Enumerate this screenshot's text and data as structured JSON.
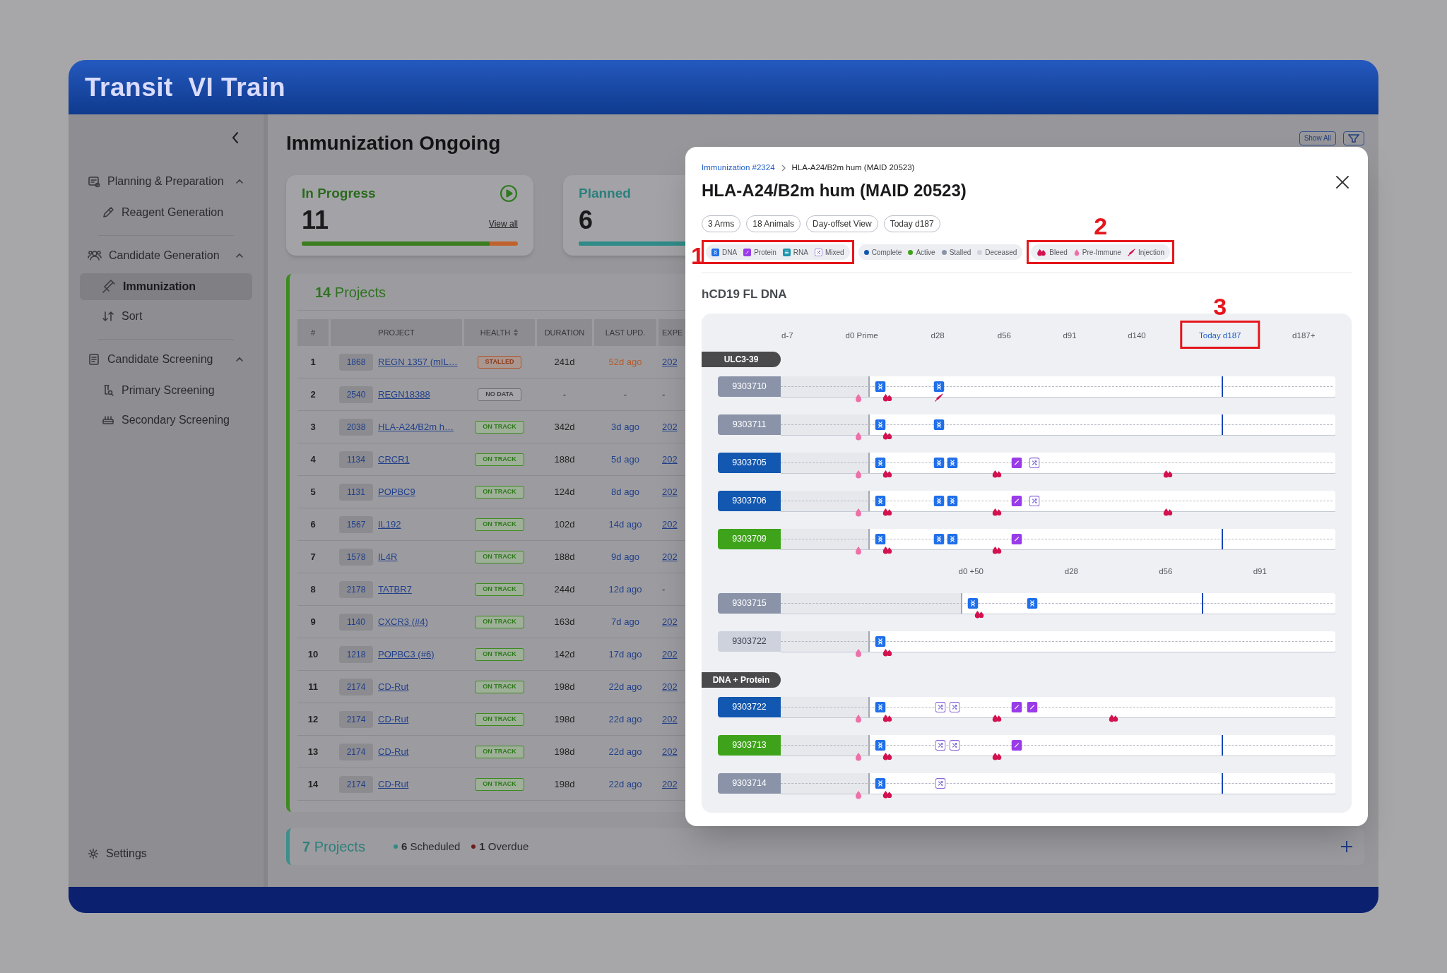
{
  "app": {
    "title": "Transit  VI Train"
  },
  "sidebar": {
    "sections": [
      {
        "label": "Planning & Preparation",
        "expanded": true,
        "items": [
          {
            "label": "Reagent Generation",
            "selected": false
          }
        ]
      },
      {
        "label": "Candidate Generation",
        "expanded": true,
        "items": [
          {
            "label": "Immunization",
            "selected": true
          },
          {
            "label": "Sort",
            "selected": false
          }
        ]
      },
      {
        "label": "Candidate Screening",
        "expanded": true,
        "items": [
          {
            "label": "Primary Screening",
            "selected": false
          },
          {
            "label": "Secondary Screening",
            "selected": false
          }
        ]
      }
    ],
    "settings": "Settings"
  },
  "main": {
    "title": "Immunization Ongoing",
    "show_all": "Show All",
    "cards": [
      {
        "title": "In Progress",
        "kind": "progress",
        "count": "11",
        "link": "View all",
        "level": 0.87
      },
      {
        "title": "Planned",
        "kind": "planned",
        "count": "6",
        "level": 1
      }
    ],
    "projects": {
      "heading": "**14** Projects",
      "columns": [
        {
          "label": "#",
          "sortable": false
        },
        {
          "label": "PROJECT",
          "sortable": false
        },
        {
          "label": "HEALTH",
          "sortable": true
        },
        {
          "label": "DURATION",
          "sortable": false
        },
        {
          "label": "LAST UPD.",
          "sortable": false
        },
        {
          "label": "EXPE",
          "sortable": false
        }
      ],
      "rows": [
        {
          "num": "1",
          "id": "1868",
          "name": "REGN 1357 (mIL…",
          "health": "STALLED",
          "kind": "stalled",
          "duration": "241d",
          "last_update": "52d ago",
          "late": true,
          "muted": false,
          "expected": "202",
          "expected_link": true
        },
        {
          "num": "2",
          "id": "2540",
          "name": "REGN18388",
          "health": "NO DATA",
          "kind": "none",
          "duration": "-",
          "last_update": "-",
          "late": false,
          "muted": true,
          "expected": "-",
          "expected_link": false
        },
        {
          "num": "3",
          "id": "2038",
          "name": "HLA-A24/B2m h…",
          "health": "ON TRACK",
          "kind": "ok",
          "duration": "342d",
          "last_update": "3d ago",
          "late": false,
          "muted": false,
          "expected": "202",
          "expected_link": true
        },
        {
          "num": "4",
          "id": "1134",
          "name": "CRCR1",
          "health": "ON TRACK",
          "kind": "ok",
          "duration": "188d",
          "last_update": "5d ago",
          "late": false,
          "muted": false,
          "expected": "202",
          "expected_link": true
        },
        {
          "num": "5",
          "id": "1131",
          "name": "POPBC9",
          "health": "ON TRACK",
          "kind": "ok",
          "duration": "124d",
          "last_update": "8d ago",
          "late": false,
          "muted": false,
          "expected": "202",
          "expected_link": true
        },
        {
          "num": "6",
          "id": "1567",
          "name": "IL192",
          "health": "ON TRACK",
          "kind": "ok",
          "duration": "102d",
          "last_update": "14d ago",
          "late": false,
          "muted": false,
          "expected": "202",
          "expected_link": true
        },
        {
          "num": "7",
          "id": "1578",
          "name": "IL4R",
          "health": "ON TRACK",
          "kind": "ok",
          "duration": "188d",
          "last_update": "9d ago",
          "late": false,
          "muted": false,
          "expected": "202",
          "expected_link": true
        },
        {
          "num": "8",
          "id": "2178",
          "name": "TATBR7",
          "health": "ON TRACK",
          "kind": "ok",
          "duration": "244d",
          "last_update": "12d ago",
          "late": false,
          "muted": false,
          "expected": "-",
          "expected_link": false
        },
        {
          "num": "9",
          "id": "1140",
          "name": "CXCR3 (#4)",
          "health": "ON TRACK",
          "kind": "ok",
          "duration": "163d",
          "last_update": "7d ago",
          "late": false,
          "muted": false,
          "expected": "202",
          "expected_link": true
        },
        {
          "num": "10",
          "id": "1218",
          "name": "POPBC3 (#6)",
          "health": "ON TRACK",
          "kind": "ok",
          "duration": "142d",
          "last_update": "17d ago",
          "late": false,
          "muted": false,
          "expected": "202",
          "expected_link": true
        },
        {
          "num": "11",
          "id": "2174",
          "name": "CD-Rut",
          "health": "ON TRACK",
          "kind": "ok",
          "duration": "198d",
          "last_update": "22d ago",
          "late": false,
          "muted": false,
          "expected": "202",
          "expected_link": true
        },
        {
          "num": "12",
          "id": "2174",
          "name": "CD-Rut",
          "health": "ON TRACK",
          "kind": "ok",
          "duration": "198d",
          "last_update": "22d ago",
          "late": false,
          "muted": false,
          "expected": "202",
          "expected_link": true
        },
        {
          "num": "13",
          "id": "2174",
          "name": "CD-Rut",
          "health": "ON TRACK",
          "kind": "ok",
          "duration": "198d",
          "last_update": "22d ago",
          "late": false,
          "muted": false,
          "expected": "202",
          "expected_link": true
        },
        {
          "num": "14",
          "id": "2174",
          "name": "CD-Rut",
          "health": "ON TRACK",
          "kind": "ok",
          "duration": "198d",
          "last_update": "22d ago",
          "late": false,
          "muted": false,
          "expected": "202",
          "expected_link": true
        }
      ]
    },
    "scheduled": {
      "heading": "**7** Projects",
      "stats": [
        {
          "text": "**6** Scheduled",
          "color": "#2f8a84"
        },
        {
          "text": "**1** Overdue",
          "color": "#6e1c1c"
        }
      ]
    }
  },
  "modal": {
    "breadcrumb": [
      "Immunization #2324",
      "HLA-A24/B2m hum (MAID 20523)"
    ],
    "title": "HLA-A24/B2m hum (MAID 20523)",
    "chips": [
      "3 Arms",
      "18 Animals",
      "Day-offset View",
      "Today d187"
    ],
    "legend": [
      {
        "kind": "types",
        "annotation": {
          "label": "1",
          "kind": "left"
        },
        "items": [
          {
            "label": "DNA",
            "kind": "dna"
          },
          {
            "label": "Protein",
            "kind": "protein"
          },
          {
            "label": "RNA",
            "kind": "rna"
          },
          {
            "label": "Mixed",
            "kind": "mixed"
          }
        ]
      },
      {
        "kind": "statuses",
        "items": [
          {
            "label": "Complete",
            "kind": "complete",
            "color": "#1257b0"
          },
          {
            "label": "Active",
            "kind": "active",
            "color": "#3ea31a"
          },
          {
            "label": "Stalled",
            "kind": "stalled",
            "color": "#8a93a8"
          },
          {
            "label": "Deceased",
            "kind": "deceased",
            "color": "#cdd2dd"
          }
        ]
      },
      {
        "kind": "events",
        "annotation": {
          "label": "2",
          "kind": "top"
        },
        "items": [
          {
            "label": "Bleed",
            "kind": "bleed"
          },
          {
            "label": "Pre-Immune",
            "kind": "pre_immune"
          },
          {
            "label": "Injection",
            "kind": "injection"
          }
        ]
      }
    ],
    "section": "hCD19 FL DNA",
    "timeline": [
      {
        "kind": "axis",
        "ticks": [
          {
            "label": "d-7",
            "today": false
          },
          {
            "label": "d0 Prime",
            "today": false
          },
          {
            "label": "d28",
            "today": false
          },
          {
            "label": "d56",
            "today": false
          },
          {
            "label": "d91",
            "today": false
          },
          {
            "label": "d140",
            "today": false
          },
          {
            "label": "Today d187",
            "today": true,
            "annotation": {
              "label": "3",
              "kind": "top"
            }
          },
          {
            "label": "d187+",
            "today": false
          }
        ]
      },
      {
        "kind": "group",
        "label": "ULC3-39"
      },
      {
        "kind": "animal",
        "id": "9303710",
        "color": "#8a93a8",
        "events": [
          {
            "kind": "start",
            "level": 0.161
          },
          {
            "kind": "dna",
            "level": 0.179
          },
          {
            "kind": "dna",
            "level": 0.285
          },
          {
            "kind": "today",
            "level": 0.795
          },
          {
            "kind": "pre_immune",
            "level": 0.14
          },
          {
            "kind": "bleed",
            "level": 0.192
          },
          {
            "kind": "injection",
            "level": 0.285
          }
        ]
      },
      {
        "kind": "animal",
        "id": "9303711",
        "color": "#8a93a8",
        "events": [
          {
            "kind": "start",
            "level": 0.161
          },
          {
            "kind": "dna",
            "level": 0.179
          },
          {
            "kind": "dna",
            "level": 0.285
          },
          {
            "kind": "today",
            "level": 0.795
          },
          {
            "kind": "pre_immune",
            "level": 0.14
          },
          {
            "kind": "bleed",
            "level": 0.192
          }
        ]
      },
      {
        "kind": "animal",
        "id": "9303705",
        "color": "#1257b0",
        "events": [
          {
            "kind": "start",
            "level": 0.161
          },
          {
            "kind": "dna",
            "level": 0.179
          },
          {
            "kind": "dna",
            "level": 0.285
          },
          {
            "kind": "dna",
            "level": 0.31
          },
          {
            "kind": "protein",
            "level": 0.426
          },
          {
            "kind": "mixed",
            "level": 0.457
          },
          {
            "kind": "pre_immune",
            "level": 0.14
          },
          {
            "kind": "bleed",
            "level": 0.192
          },
          {
            "kind": "bleed",
            "level": 0.39
          },
          {
            "kind": "bleed",
            "level": 0.698
          }
        ]
      },
      {
        "kind": "animal",
        "id": "9303706",
        "color": "#1257b0",
        "events": [
          {
            "kind": "start",
            "level": 0.161
          },
          {
            "kind": "dna",
            "level": 0.179
          },
          {
            "kind": "dna",
            "level": 0.285
          },
          {
            "kind": "dna",
            "level": 0.31
          },
          {
            "kind": "protein",
            "level": 0.426
          },
          {
            "kind": "mixed",
            "level": 0.457
          },
          {
            "kind": "pre_immune",
            "level": 0.14
          },
          {
            "kind": "bleed",
            "level": 0.192
          },
          {
            "kind": "bleed",
            "level": 0.39
          },
          {
            "kind": "bleed",
            "level": 0.698
          }
        ]
      },
      {
        "kind": "animal",
        "id": "9303709",
        "color": "#3ea31a",
        "events": [
          {
            "kind": "start",
            "level": 0.161
          },
          {
            "kind": "dna",
            "level": 0.179
          },
          {
            "kind": "dna",
            "level": 0.285
          },
          {
            "kind": "dna",
            "level": 0.31
          },
          {
            "kind": "protein",
            "level": 0.426
          },
          {
            "kind": "today",
            "level": 0.795
          },
          {
            "kind": "pre_immune",
            "level": 0.14
          },
          {
            "kind": "bleed",
            "level": 0.192
          },
          {
            "kind": "bleed",
            "level": 0.39
          }
        ]
      },
      {
        "kind": "axis",
        "ticks": [
          {
            "label": "d0 +50",
            "today": false
          },
          {
            "label": "d28",
            "today": false
          },
          {
            "label": "d56",
            "today": false
          },
          {
            "label": "d91",
            "today": false
          }
        ]
      },
      {
        "kind": "animal",
        "id": "9303715",
        "color": "#8a93a8",
        "events": [
          {
            "kind": "start",
            "level": 0.328
          },
          {
            "kind": "dna",
            "level": 0.346
          },
          {
            "kind": "dna",
            "level": 0.453
          },
          {
            "kind": "today",
            "level": 0.759
          },
          {
            "kind": "bleed",
            "level": 0.358
          }
        ]
      },
      {
        "kind": "animal",
        "id": "9303722",
        "color": "#cdd2dd",
        "events": [
          {
            "kind": "start",
            "level": 0.161
          },
          {
            "kind": "dna",
            "level": 0.179
          },
          {
            "kind": "pre_immune",
            "level": 0.14
          },
          {
            "kind": "bleed",
            "level": 0.192
          }
        ]
      },
      {
        "kind": "group",
        "label": "DNA + Protein"
      },
      {
        "kind": "animal",
        "id": "9303722",
        "color": "#1257b0",
        "events": [
          {
            "kind": "start",
            "level": 0.161
          },
          {
            "kind": "dna",
            "level": 0.179
          },
          {
            "kind": "mixed",
            "level": 0.288
          },
          {
            "kind": "mixed",
            "level": 0.314
          },
          {
            "kind": "protein",
            "level": 0.426
          },
          {
            "kind": "protein",
            "level": 0.453
          },
          {
            "kind": "pre_immune",
            "level": 0.14
          },
          {
            "kind": "bleed",
            "level": 0.192
          },
          {
            "kind": "bleed",
            "level": 0.39
          },
          {
            "kind": "bleed",
            "level": 0.6
          }
        ]
      },
      {
        "kind": "animal",
        "id": "9303713",
        "color": "#3ea31a",
        "events": [
          {
            "kind": "start",
            "level": 0.161
          },
          {
            "kind": "dna",
            "level": 0.179
          },
          {
            "kind": "mixed",
            "level": 0.288
          },
          {
            "kind": "mixed",
            "level": 0.314
          },
          {
            "kind": "protein",
            "level": 0.426
          },
          {
            "kind": "today",
            "level": 0.795
          },
          {
            "kind": "pre_immune",
            "level": 0.14
          },
          {
            "kind": "bleed",
            "level": 0.192
          },
          {
            "kind": "bleed",
            "level": 0.39
          }
        ]
      },
      {
        "kind": "animal",
        "id": "9303714",
        "color": "#8a93a8",
        "events": [
          {
            "kind": "start",
            "level": 0.161
          },
          {
            "kind": "dna",
            "level": 0.179
          },
          {
            "kind": "mixed",
            "level": 0.288
          },
          {
            "kind": "today",
            "level": 0.795
          },
          {
            "kind": "pre_immune",
            "level": 0.14
          },
          {
            "kind": "bleed",
            "level": 0.192
          }
        ]
      }
    ]
  }
}
